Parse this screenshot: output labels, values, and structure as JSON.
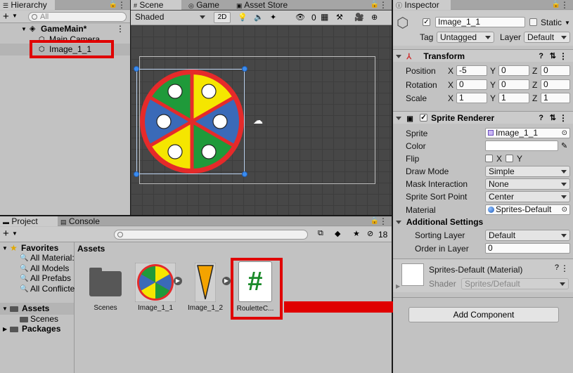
{
  "hierarchy": {
    "tab_label": "Hierarchy",
    "search_placeholder": "All",
    "root": "GameMain*",
    "items": [
      "Main Camera",
      "Image_1_1"
    ]
  },
  "scene": {
    "tabs": [
      "Scene",
      "Game",
      "Asset Store"
    ],
    "shading": "Shaded",
    "mode_2d": "2D",
    "gizmo_count": "0"
  },
  "project": {
    "tabs": [
      "Project",
      "Console"
    ],
    "hidden_count": "18",
    "favorites_label": "Favorites",
    "favorites": [
      "All Material:",
      "All Models",
      "All Prefabs",
      "All Conflicte"
    ],
    "assets_label": "Assets",
    "assets_children": [
      "Scenes"
    ],
    "packages_label": "Packages",
    "breadcrumb": "Assets",
    "grid": [
      "Scenes",
      "Image_1_1",
      "Image_1_2",
      "RouletteC..."
    ]
  },
  "inspector": {
    "tab_label": "Inspector",
    "object_name": "Image_1_1",
    "static_label": "Static",
    "tag_label": "Tag",
    "tag_value": "Untagged",
    "layer_label": "Layer",
    "layer_value": "Default",
    "transform": {
      "title": "Transform",
      "rows": [
        {
          "label": "Position",
          "x": "-5",
          "y": "0",
          "z": "0"
        },
        {
          "label": "Rotation",
          "x": "0",
          "y": "0",
          "z": "0"
        },
        {
          "label": "Scale",
          "x": "1",
          "y": "1",
          "z": "1"
        }
      ]
    },
    "sprite_renderer": {
      "title": "Sprite Renderer",
      "sprite_label": "Sprite",
      "sprite_value": "Image_1_1",
      "color_label": "Color",
      "color_value": "#ffffff",
      "flip_label": "Flip",
      "flip_x": "X",
      "flip_y": "Y",
      "draw_mode_label": "Draw Mode",
      "draw_mode_value": "Simple",
      "mask_label": "Mask Interaction",
      "mask_value": "None",
      "sort_point_label": "Sprite Sort Point",
      "sort_point_value": "Center",
      "material_label": "Material",
      "material_value": "Sprites-Default",
      "additional_title": "Additional Settings",
      "sorting_layer_label": "Sorting Layer",
      "sorting_layer_value": "Default",
      "order_label": "Order in Layer",
      "order_value": "0"
    },
    "material": {
      "title": "Sprites-Default (Material)",
      "shader_label": "Shader",
      "shader_value": "Sprites/Default"
    },
    "add_component": "Add Component"
  },
  "colors": {
    "highlight_red": "#e00000",
    "wheel_red": "#e52a2a",
    "wheel_green": "#1f9a3a",
    "wheel_yellow": "#f5e600",
    "wheel_blue": "#3a6ab8"
  }
}
